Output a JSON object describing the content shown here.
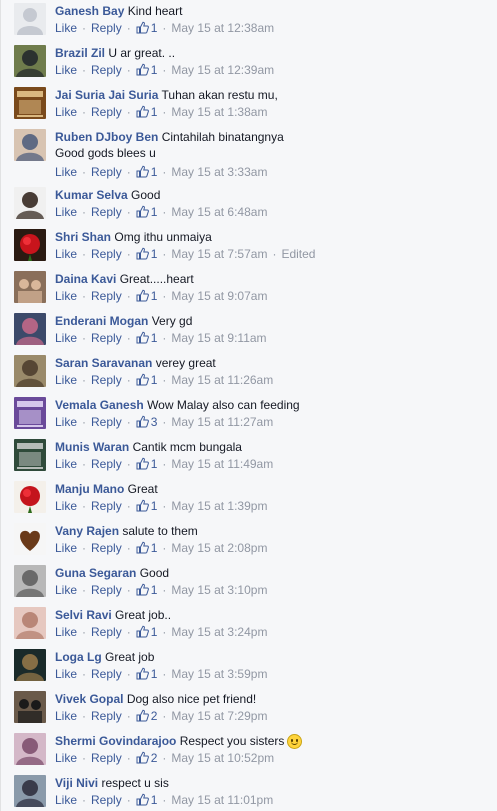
{
  "ui": {
    "like_label": "Like",
    "reply_label": "Reply",
    "separator": "·"
  },
  "comments": [
    {
      "author": "Ganesh Bay",
      "text": "Kind heart",
      "likes": "1",
      "time": "May 15 at 12:38am",
      "edited": "",
      "avatar": {
        "bg": "#e9ebee",
        "fg": "#c5c9d1",
        "style": "default"
      }
    },
    {
      "author": "Brazil Zil",
      "text": "U ar great. ..",
      "likes": "1",
      "time": "May 15 at 12:39am",
      "edited": "",
      "avatar": {
        "bg": "#6f7c4c",
        "fg": "#20242a",
        "style": "face"
      }
    },
    {
      "author": "Jai Suria Jai Suria",
      "text": "Tuhan akan restu mu,",
      "likes": "1",
      "time": "May 15 at 1:38am",
      "edited": "",
      "avatar": {
        "bg": "#7a4a1c",
        "fg": "#f2d39a",
        "style": "poster"
      }
    },
    {
      "author": "Ruben DJboy Ben",
      "text": "Cintahilah binatangnya Good gods blees u",
      "likes": "1",
      "time": "May 15 at 3:33am",
      "edited": "",
      "avatar": {
        "bg": "#d8c4b2",
        "fg": "#4a5a7a",
        "style": "face"
      }
    },
    {
      "author": "Kumar Selva",
      "text": "Good",
      "likes": "1",
      "time": "May 15 at 6:48am",
      "edited": "",
      "avatar": {
        "bg": "#f0f0f0",
        "fg": "#2a1c14",
        "style": "face"
      }
    },
    {
      "author": "Shri Shan",
      "text": "Omg ithu unmaiya",
      "likes": "1",
      "time": "May 15 at 7:57am",
      "edited": "Edited",
      "avatar": {
        "bg": "#2a1a12",
        "fg": "#c8141c",
        "style": "rose"
      }
    },
    {
      "author": "Daina Kavi",
      "text": "Great.....heart",
      "likes": "1",
      "time": "May 15 at 9:07am",
      "edited": "",
      "avatar": {
        "bg": "#8a6f5a",
        "fg": "#d9b79a",
        "style": "group"
      }
    },
    {
      "author": "Enderani Mogan",
      "text": "Very gd",
      "likes": "1",
      "time": "May 15 at 9:11am",
      "edited": "",
      "avatar": {
        "bg": "#3c4a6a",
        "fg": "#c86a8a",
        "style": "face"
      }
    },
    {
      "author": "Saran Saravanan",
      "text": "verey great",
      "likes": "1",
      "time": "May 15 at 11:26am",
      "edited": "",
      "avatar": {
        "bg": "#9a8a6a",
        "fg": "#4a3a2a",
        "style": "face"
      }
    },
    {
      "author": "Vemala Ganesh",
      "text": "Wow Malay also can feeding",
      "likes": "3",
      "time": "May 15 at 11:27am",
      "edited": "",
      "avatar": {
        "bg": "#6a4a9a",
        "fg": "#f0e6ff",
        "style": "poster"
      }
    },
    {
      "author": "Munis Waran",
      "text": "Cantik mcm bungala",
      "likes": "1",
      "time": "May 15 at 11:49am",
      "edited": "",
      "avatar": {
        "bg": "#2f4a3a",
        "fg": "#d8d8d8",
        "style": "poster"
      }
    },
    {
      "author": "Manju Mano",
      "text": "Great",
      "likes": "1",
      "time": "May 15 at 1:39pm",
      "edited": "",
      "avatar": {
        "bg": "#f4f0ea",
        "fg": "#c4141c",
        "style": "rose"
      }
    },
    {
      "author": "Vany Rajen",
      "text": "salute to them",
      "likes": "1",
      "time": "May 15 at 2:08pm",
      "edited": "",
      "avatar": {
        "bg": "#f6f6f6",
        "fg": "#6a3a1a",
        "style": "heart"
      }
    },
    {
      "author": "Guna Segaran",
      "text": "Good",
      "likes": "1",
      "time": "May 15 at 3:10pm",
      "edited": "",
      "avatar": {
        "bg": "#b8b8b8",
        "fg": "#5a5a5a",
        "style": "face"
      }
    },
    {
      "author": "Selvi Ravi",
      "text": "Great job..",
      "likes": "1",
      "time": "May 15 at 3:24pm",
      "edited": "",
      "avatar": {
        "bg": "#e6c8c0",
        "fg": "#b07a6a",
        "style": "face"
      }
    },
    {
      "author": "Loga Lg",
      "text": "Great job",
      "likes": "1",
      "time": "May 15 at 3:59pm",
      "edited": "",
      "avatar": {
        "bg": "#1a2a2a",
        "fg": "#9a7a4a",
        "style": "face"
      }
    },
    {
      "author": "Vivek Gopal",
      "text": "Dog also nice pet friend!",
      "likes": "2",
      "time": "May 15 at 7:29pm",
      "edited": "",
      "avatar": {
        "bg": "#6a5a4a",
        "fg": "#1a1a1a",
        "style": "group"
      }
    },
    {
      "author": "Shermi Govindarajoo",
      "text": "Respect you sisters",
      "likes": "2",
      "time": "May 15 at 10:52pm",
      "edited": "",
      "avatar": {
        "bg": "#d4b8c8",
        "fg": "#7a4a6a",
        "style": "face"
      },
      "emoji": "smiley"
    },
    {
      "author": "Viji Nivi",
      "text": "respect u sis",
      "likes": "1",
      "time": "May 15 at 11:01pm",
      "edited": "",
      "avatar": {
        "bg": "#8a9aaa",
        "fg": "#2a2a3a",
        "style": "face"
      }
    }
  ]
}
